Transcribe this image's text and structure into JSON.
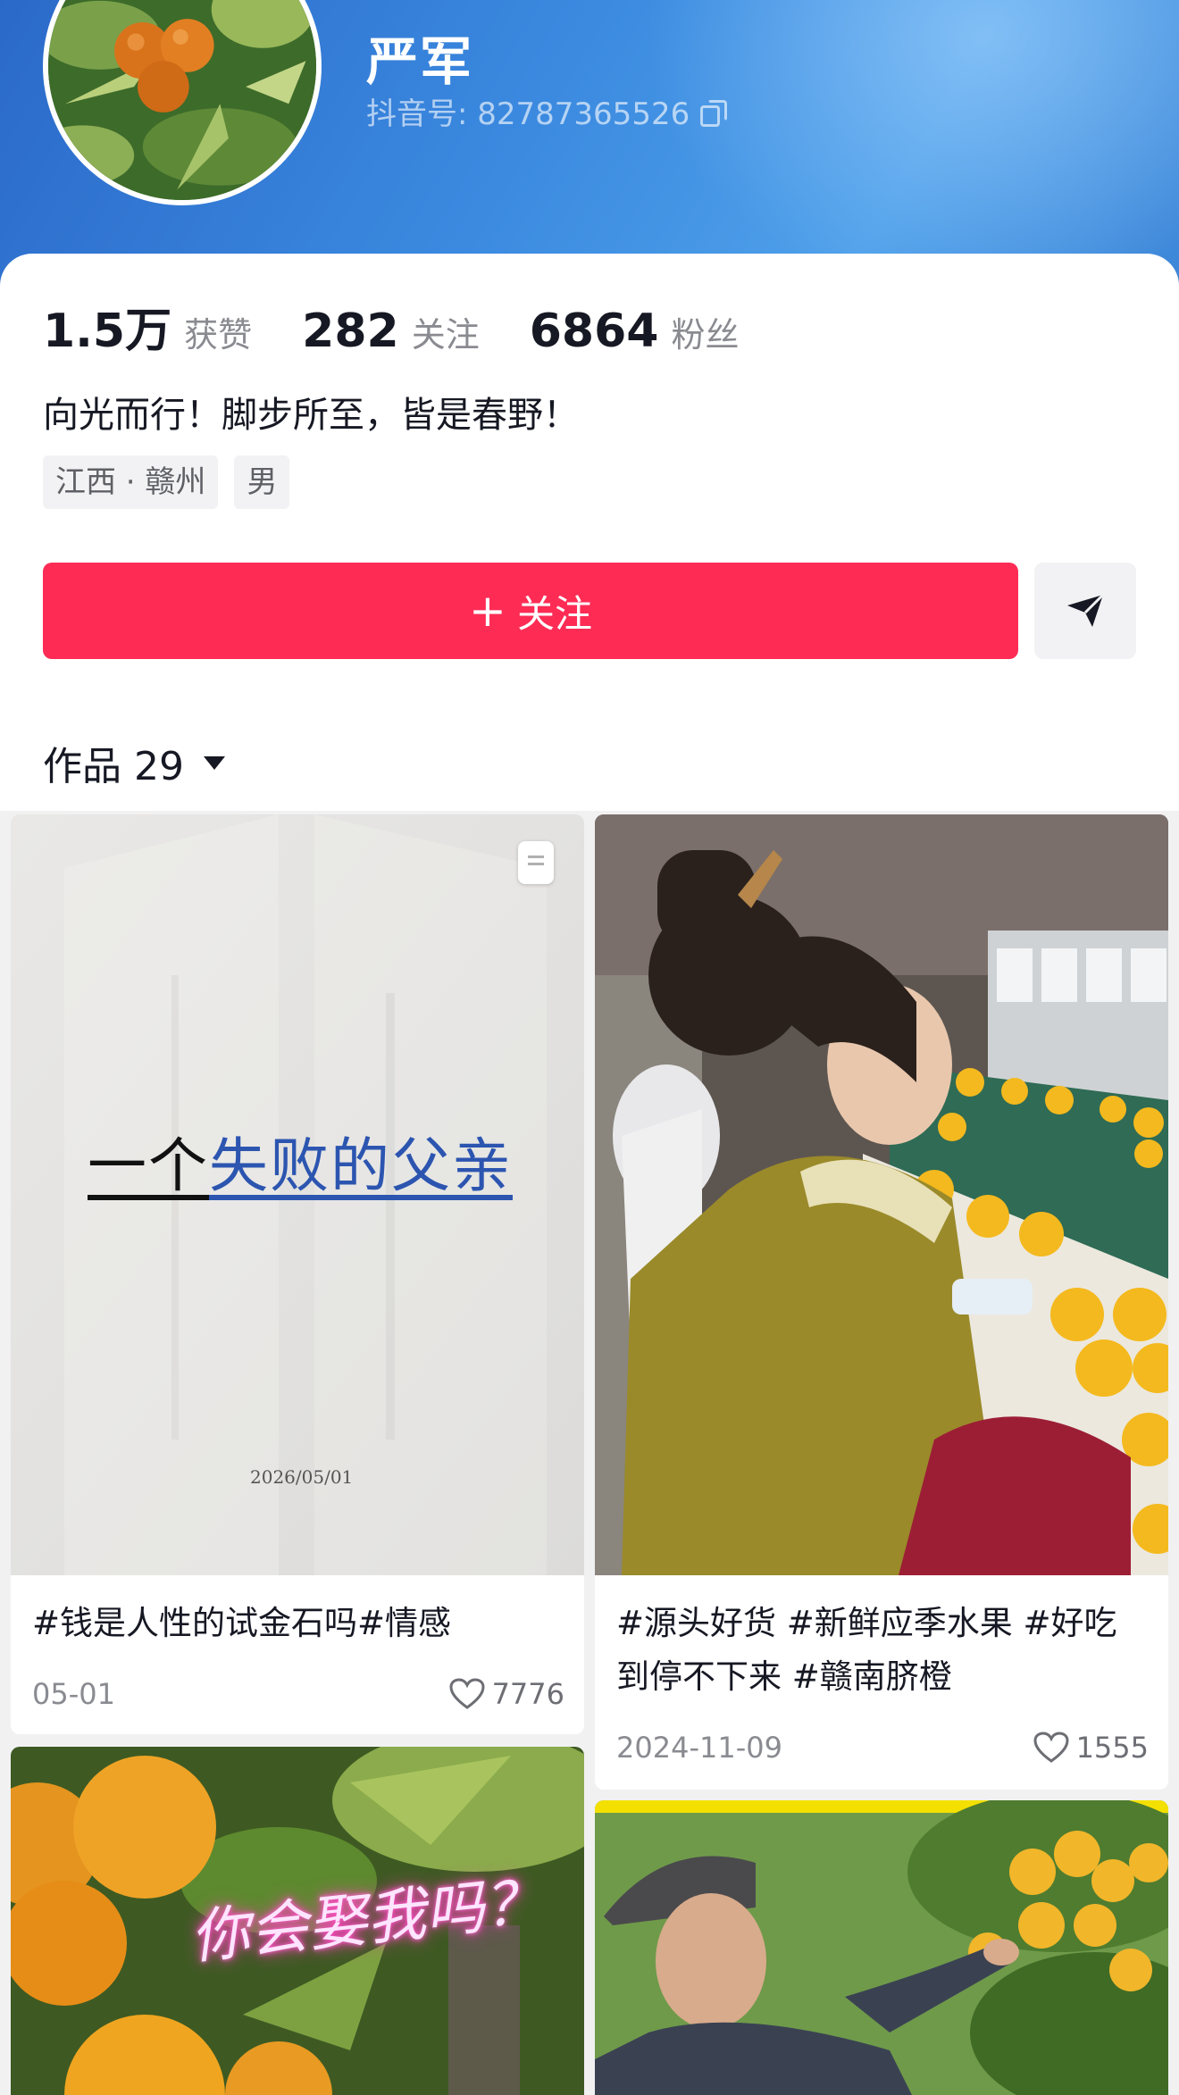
{
  "profile": {
    "nickname": "严军",
    "douyin_id": "抖音号: 82787365526",
    "stats": [
      {
        "value": "1.5万",
        "label": "获赞"
      },
      {
        "value": "282",
        "label": "关注"
      },
      {
        "value": "6864",
        "label": "粉丝"
      }
    ],
    "signature": "向光而行！脚步所至，皆是春野！",
    "tags": [
      "江西 · 赣州",
      "男"
    ],
    "follow_label": "关注",
    "follow_plus": "+"
  },
  "works_tab": {
    "label": "作品 29"
  },
  "videos": [
    {
      "caption": "#钱是人性的试金石吗#情感",
      "date": "05-01",
      "likes": "7776",
      "cover_title_a": "一个",
      "cover_title_b": "失败的父亲",
      "cover_date": "2026/05/01"
    },
    {
      "caption": "#源头好货 #新鲜应季水果 #好吃到停不下来 #赣南脐橙",
      "date": "2024-11-09",
      "likes": "1555"
    },
    {
      "overlay": "你会娶我吗？"
    },
    {}
  ],
  "colors": {
    "accent": "#fe2c55",
    "header_blue": "#3b8ae0"
  }
}
